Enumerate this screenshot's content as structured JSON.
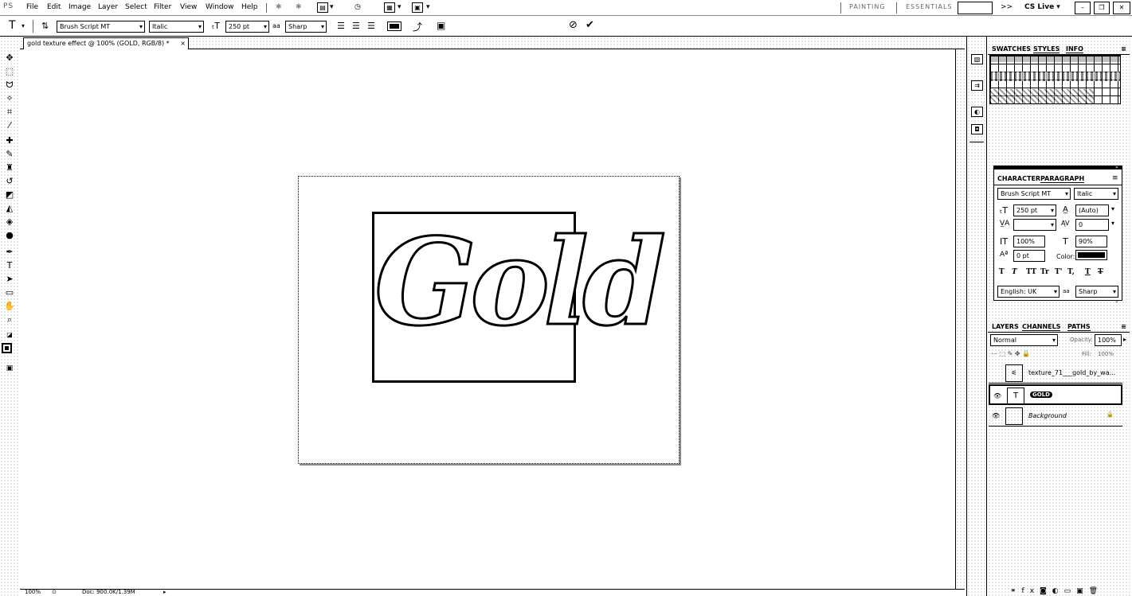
{
  "app": {
    "logo": "PS"
  },
  "menu": [
    "File",
    "Edit",
    "Image",
    "Layer",
    "Select",
    "Filter",
    "View",
    "Window",
    "Help"
  ],
  "workspace_switcher": {
    "items": [
      "PAINTING",
      "ESSENTIALS"
    ],
    "more": ">>",
    "cs_live": "CS Live ▾"
  },
  "options": {
    "tool_glyph": "T",
    "font_family": "Brush Script MT",
    "font_style": "Italic",
    "font_size": "250 pt",
    "aa_label": "aa",
    "antialias": "Sharp",
    "cancel_glyph": "⊘",
    "commit_glyph": "✔"
  },
  "document": {
    "tab_title": "gold texture effect @ 100% (GOLD, RGB/8) *",
    "close_glyph": "×",
    "canvas_text": "Gold"
  },
  "status": {
    "zoom": "100%",
    "doc": "Doc: 900.0K/1.39M"
  },
  "swatches_panel": {
    "tabs": [
      "SWATCHES",
      "STYLES",
      "INFO"
    ]
  },
  "character_panel": {
    "tabs": [
      "CHARACTER",
      "PARAGRAPH"
    ],
    "font_family": "Brush Script MT",
    "font_style": "Italic",
    "size": "250 pt",
    "leading": "(Auto)",
    "kerning": "",
    "tracking": "0",
    "vscale": "100%",
    "hscale": "90%",
    "baseline": "0 pt",
    "color_label": "Color:",
    "type_buttons": [
      "T",
      "T",
      "TT",
      "Tr",
      "T'",
      "T,",
      "T",
      "T"
    ],
    "language": "English: UK",
    "aa_label": "aa",
    "antialias": "Sharp"
  },
  "layers_panel": {
    "tabs": [
      "LAYERS",
      "CHANNELS",
      "PATHS"
    ],
    "blend_mode": "Normal",
    "opacity_label": "Opacity:",
    "opacity": "100%",
    "fill_label": "Fill:",
    "fill": "100%",
    "layers": [
      {
        "name": "texture_71___gold_by_wa...",
        "thumb": "",
        "visible": false
      },
      {
        "name": "GOLD",
        "thumb": "T",
        "visible": true
      },
      {
        "name": "Background",
        "thumb": "",
        "visible": true
      }
    ],
    "lock_glyph": "🔒"
  }
}
